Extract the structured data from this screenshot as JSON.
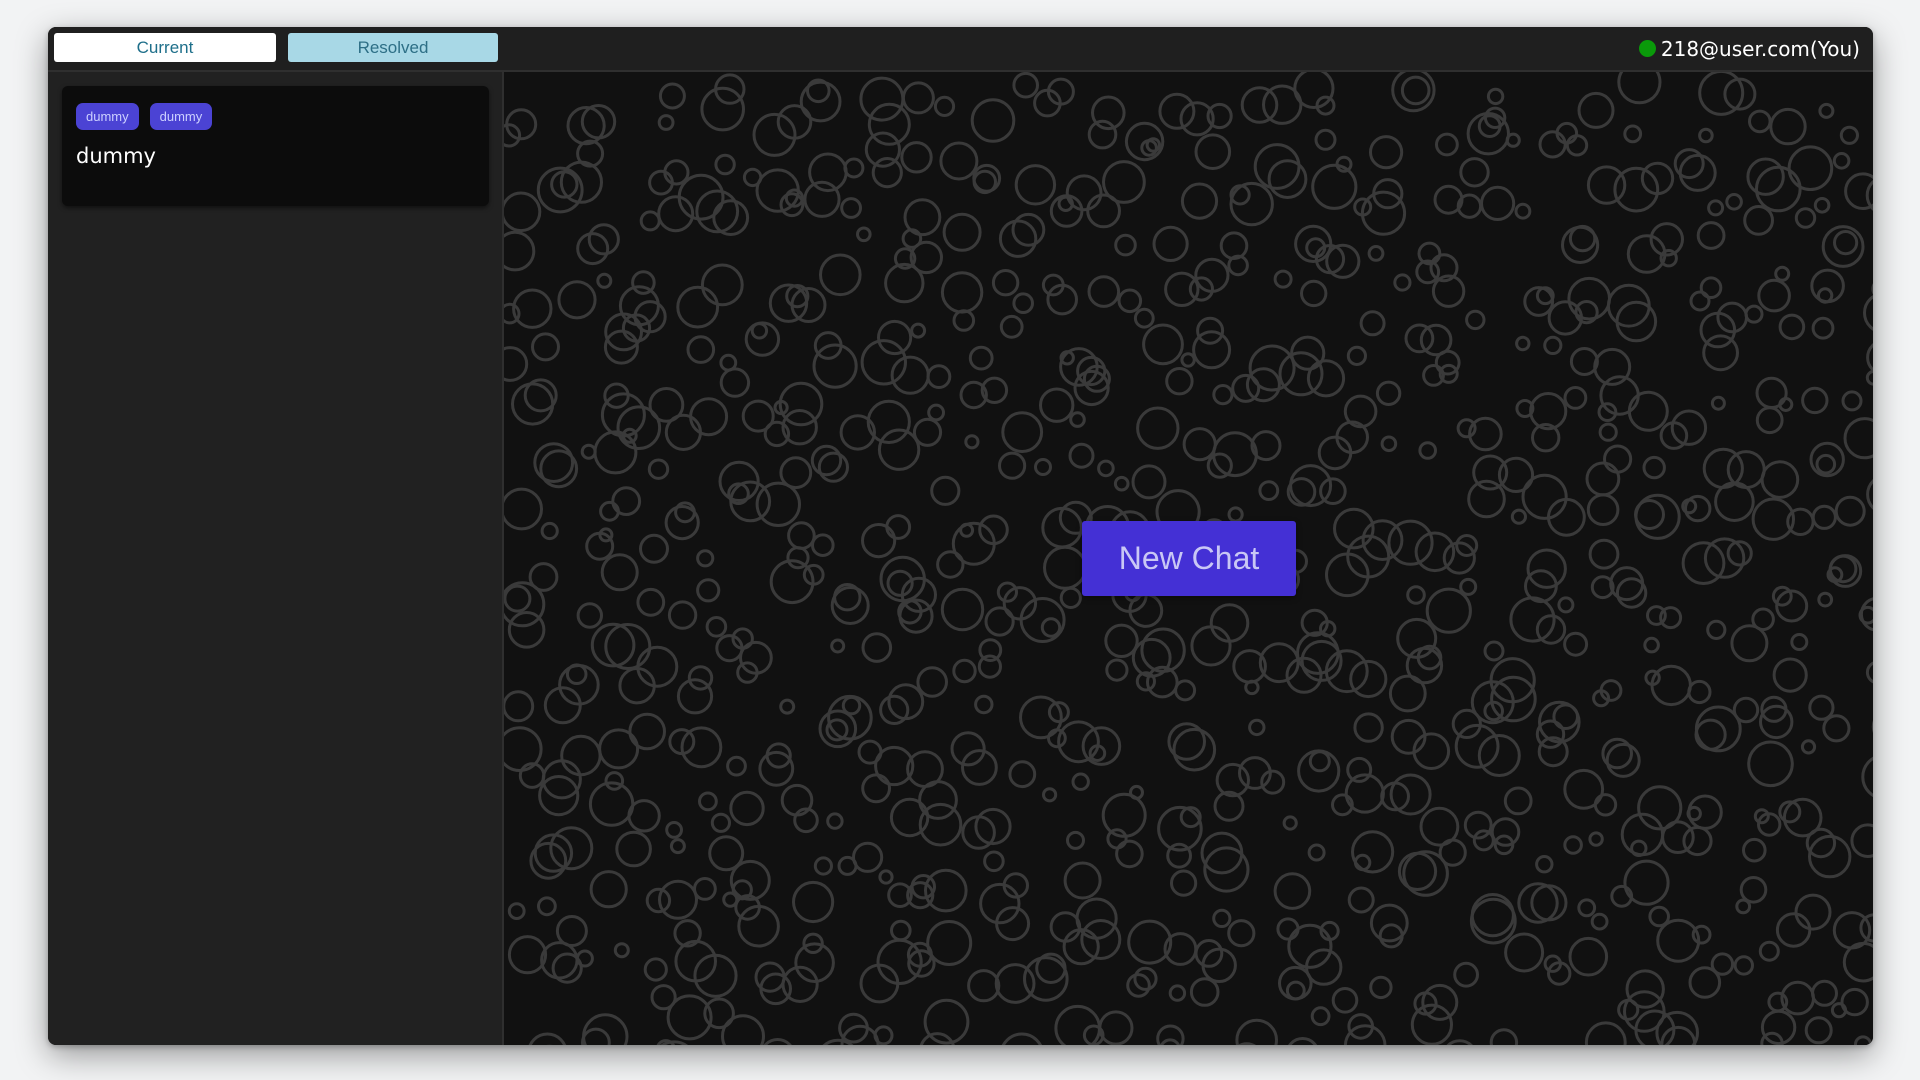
{
  "tabs": {
    "current_label": "Current",
    "resolved_label": "Resolved"
  },
  "user": {
    "label": "218@user.com(You)",
    "status_color": "#0a9a0a"
  },
  "chat_list": [
    {
      "tags": [
        "dummy",
        "dummy"
      ],
      "title": "dummy"
    }
  ],
  "main": {
    "new_chat_label": "New Chat",
    "accent_color": "#4430d5"
  }
}
